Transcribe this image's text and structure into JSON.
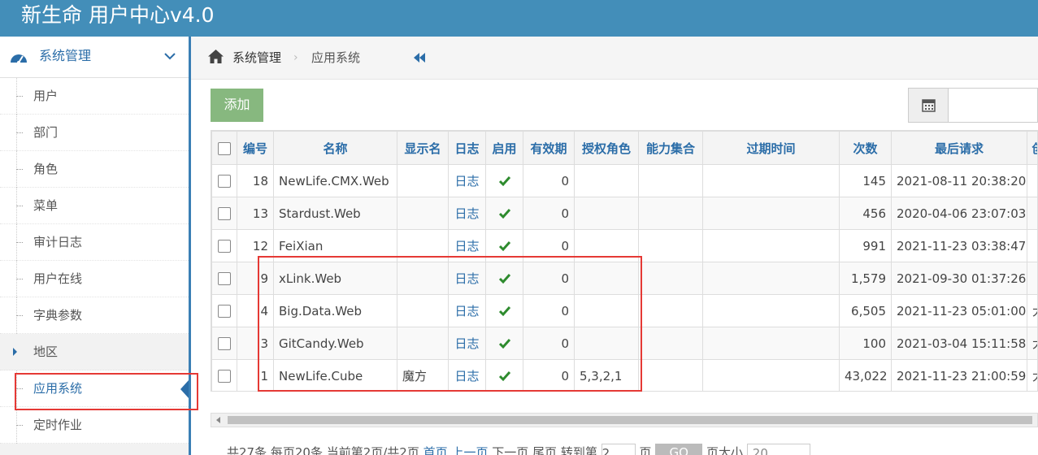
{
  "app": {
    "title": "新生命 用户中心v4.0"
  },
  "sidebar": {
    "section": "系统管理",
    "items": [
      {
        "label": "用户"
      },
      {
        "label": "部门"
      },
      {
        "label": "角色"
      },
      {
        "label": "菜单"
      },
      {
        "label": "审计日志"
      },
      {
        "label": "用户在线"
      },
      {
        "label": "字典参数"
      },
      {
        "label": "地区"
      },
      {
        "label": "应用系统"
      },
      {
        "label": "定时作业"
      }
    ]
  },
  "breadcrumb": {
    "items": [
      "系统管理",
      "应用系统"
    ],
    "separator": "›"
  },
  "toolbar": {
    "add_label": "添加"
  },
  "table": {
    "headers": [
      "编号",
      "名称",
      "显示名",
      "日志",
      "启用",
      "有效期",
      "授权角色",
      "能力集合",
      "过期时间",
      "次数",
      "最后请求",
      "创"
    ],
    "rows": [
      {
        "id": "18",
        "name": "NewLife.CMX.Web",
        "display": "",
        "log": "日志",
        "enabled": true,
        "validity": "0",
        "roles": "",
        "caps": "",
        "expire": "",
        "count": "145",
        "last": "2021-08-11 20:38:20",
        "extra": ""
      },
      {
        "id": "13",
        "name": "Stardust.Web",
        "display": "",
        "log": "日志",
        "enabled": true,
        "validity": "0",
        "roles": "",
        "caps": "",
        "expire": "",
        "count": "456",
        "last": "2020-04-06 23:07:03",
        "extra": ""
      },
      {
        "id": "12",
        "name": "FeiXian",
        "display": "",
        "log": "日志",
        "enabled": true,
        "validity": "0",
        "roles": "",
        "caps": "",
        "expire": "",
        "count": "991",
        "last": "2021-11-23 03:38:47",
        "extra": ""
      },
      {
        "id": "9",
        "name": "xLink.Web",
        "display": "",
        "log": "日志",
        "enabled": true,
        "validity": "0",
        "roles": "",
        "caps": "",
        "expire": "",
        "count": "1,579",
        "last": "2021-09-30 01:37:26",
        "extra": ""
      },
      {
        "id": "4",
        "name": "Big.Data.Web",
        "display": "",
        "log": "日志",
        "enabled": true,
        "validity": "0",
        "roles": "",
        "caps": "",
        "expire": "",
        "count": "6,505",
        "last": "2021-11-23 05:01:00",
        "extra": "大"
      },
      {
        "id": "3",
        "name": "GitCandy.Web",
        "display": "",
        "log": "日志",
        "enabled": true,
        "validity": "0",
        "roles": "",
        "caps": "",
        "expire": "",
        "count": "100",
        "last": "2021-03-04 15:11:58",
        "extra": "大"
      },
      {
        "id": "1",
        "name": "NewLife.Cube",
        "display": "魔方",
        "log": "日志",
        "enabled": true,
        "validity": "0",
        "roles": "5,3,2,1",
        "caps": "",
        "expire": "",
        "count": "43,022",
        "last": "2021-11-23 21:00:59",
        "extra": "大"
      }
    ]
  },
  "pager": {
    "summary": "共27条 每页20条 当前第2页/共2页",
    "first": "首页",
    "prev": "上一页",
    "next": "下一页",
    "last": "尾页",
    "goto_prefix": "转到第",
    "goto_value": "2",
    "goto_suffix": "页",
    "go_label": "GO",
    "size_label": "页大小",
    "size_value": "20"
  },
  "colors": {
    "topbar": "#438eb9",
    "accent": "#2b6da8",
    "add_button": "#87b87f",
    "highlight_box": "#e53935",
    "check": "#2e8b2e"
  }
}
